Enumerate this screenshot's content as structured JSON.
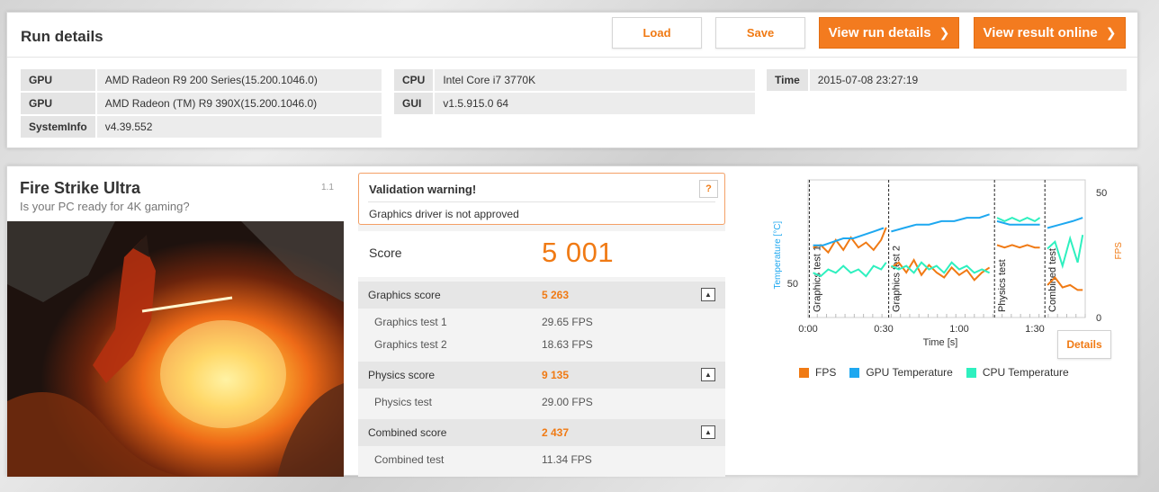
{
  "header": {
    "title": "Run details",
    "buttons": {
      "load": "Load",
      "save": "Save",
      "view_run_details": "View run details",
      "view_result_online": "View result online"
    }
  },
  "info": {
    "col1": [
      {
        "key": "GPU",
        "value": "AMD Radeon R9 200 Series(15.200.1046.0)"
      },
      {
        "key": "GPU",
        "value": "AMD Radeon (TM) R9 390X(15.200.1046.0)"
      },
      {
        "key": "SystemInfo",
        "value": "v4.39.552"
      }
    ],
    "col2": [
      {
        "key": "CPU",
        "value": "Intel Core i7 3770K"
      },
      {
        "key": "GUI",
        "value": "v1.5.915.0 64"
      }
    ],
    "col3": [
      {
        "key": "Time",
        "value": "2015-07-08 23:27:19"
      }
    ]
  },
  "benchmark": {
    "title": "Fire Strike Ultra",
    "subtitle": "Is your PC ready for 4K gaming?",
    "version": "1.1"
  },
  "validation": {
    "title": "Validation warning!",
    "help": "?",
    "message": "Graphics driver is not approved"
  },
  "score": {
    "label": "Score",
    "value": "5 001"
  },
  "subscores": {
    "graphics": {
      "label": "Graphics score",
      "value": "5 263",
      "tests": [
        {
          "label": "Graphics test 1",
          "value": "29.65 FPS"
        },
        {
          "label": "Graphics test 2",
          "value": "18.63 FPS"
        }
      ]
    },
    "physics": {
      "label": "Physics score",
      "value": "9 135",
      "tests": [
        {
          "label": "Physics test",
          "value": "29.00 FPS"
        }
      ]
    },
    "combined": {
      "label": "Combined score",
      "value": "2 437",
      "tests": [
        {
          "label": "Combined test",
          "value": "11.34 FPS"
        }
      ]
    }
  },
  "chart": {
    "details_label": "Details",
    "colors": {
      "fps": "#f07a14",
      "gpu": "#1ea8f0",
      "cpu": "#2ef0bf"
    }
  },
  "chart_data": {
    "type": "line",
    "xlabel": "Time [s]",
    "ylabel_left": "Temperature [°C]",
    "ylabel_right": "FPS",
    "x_ticks": [
      "0:00",
      "0:30",
      "1:00",
      "1:30"
    ],
    "y_left_ticks": [
      "50"
    ],
    "y_right_ticks": [
      "50",
      "0"
    ],
    "xlim": [
      0,
      110
    ],
    "ylim_right": [
      0,
      50
    ],
    "ylim_left": [
      40,
      80
    ],
    "segments": [
      {
        "label": "Graphics test 1",
        "start": 0.5,
        "end": 32
      },
      {
        "label": "Graphics test 2",
        "start": 32,
        "end": 74
      },
      {
        "label": "Physics test",
        "start": 74,
        "end": 94
      },
      {
        "label": "Combined test",
        "start": 94,
        "end": 110
      }
    ],
    "series": [
      {
        "name": "FPS",
        "axis": "right",
        "parts": [
          [
            [
              2,
              28
            ],
            [
              5,
              29
            ],
            [
              8,
              26
            ],
            [
              11,
              31
            ],
            [
              14,
              27
            ],
            [
              17,
              32
            ],
            [
              20,
              28
            ],
            [
              23,
              30
            ],
            [
              26,
              27
            ],
            [
              29,
              31
            ],
            [
              31,
              36
            ]
          ],
          [
            [
              33,
              20
            ],
            [
              36,
              22
            ],
            [
              39,
              18
            ],
            [
              42,
              23
            ],
            [
              45,
              17
            ],
            [
              48,
              21
            ],
            [
              51,
              18
            ],
            [
              54,
              16
            ],
            [
              57,
              20
            ],
            [
              60,
              17
            ],
            [
              63,
              19
            ],
            [
              66,
              15
            ],
            [
              69,
              18
            ],
            [
              72,
              20
            ]
          ],
          [
            [
              75,
              29
            ],
            [
              78,
              28
            ],
            [
              81,
              29
            ],
            [
              84,
              28
            ],
            [
              87,
              29
            ],
            [
              90,
              28
            ],
            [
              92,
              28
            ]
          ],
          [
            [
              95,
              13
            ],
            [
              98,
              16
            ],
            [
              101,
              12
            ],
            [
              104,
              13
            ],
            [
              107,
              11
            ],
            [
              109,
              11
            ]
          ]
        ]
      },
      {
        "name": "GPU Temperature",
        "axis": "left",
        "parts": [
          [
            [
              2,
              61
            ],
            [
              6,
              61
            ],
            [
              10,
              62
            ],
            [
              14,
              63
            ],
            [
              18,
              63
            ],
            [
              22,
              64
            ],
            [
              26,
              65
            ],
            [
              30,
              66
            ]
          ],
          [
            [
              33,
              65
            ],
            [
              38,
              66
            ],
            [
              43,
              67
            ],
            [
              48,
              67
            ],
            [
              53,
              68
            ],
            [
              58,
              68
            ],
            [
              63,
              69
            ],
            [
              68,
              69
            ],
            [
              72,
              70
            ]
          ],
          [
            [
              75,
              68
            ],
            [
              80,
              67
            ],
            [
              85,
              67
            ],
            [
              90,
              67
            ],
            [
              92,
              67
            ]
          ],
          [
            [
              95,
              66
            ],
            [
              100,
              67
            ],
            [
              105,
              68
            ],
            [
              109,
              69
            ]
          ]
        ]
      },
      {
        "name": "CPU Temperature",
        "axis": "left",
        "parts": [
          [
            [
              2,
              53
            ],
            [
              5,
              52
            ],
            [
              8,
              54
            ],
            [
              11,
              53
            ],
            [
              14,
              55
            ],
            [
              17,
              53
            ],
            [
              20,
              54
            ],
            [
              23,
              52
            ],
            [
              26,
              55
            ],
            [
              29,
              54
            ],
            [
              31,
              56
            ]
          ],
          [
            [
              33,
              55
            ],
            [
              36,
              54
            ],
            [
              39,
              55
            ],
            [
              42,
              53
            ],
            [
              45,
              56
            ],
            [
              48,
              54
            ],
            [
              51,
              55
            ],
            [
              54,
              53
            ],
            [
              57,
              56
            ],
            [
              60,
              54
            ],
            [
              63,
              55
            ],
            [
              66,
              53
            ],
            [
              69,
              54
            ],
            [
              72,
              53
            ]
          ],
          [
            [
              75,
              69
            ],
            [
              78,
              68
            ],
            [
              81,
              69
            ],
            [
              84,
              68
            ],
            [
              87,
              69
            ],
            [
              90,
              68
            ],
            [
              92,
              69
            ]
          ],
          [
            [
              95,
              60
            ],
            [
              98,
              62
            ],
            [
              101,
              55
            ],
            [
              104,
              63
            ],
            [
              107,
              56
            ],
            [
              109,
              64
            ]
          ]
        ]
      }
    ]
  }
}
